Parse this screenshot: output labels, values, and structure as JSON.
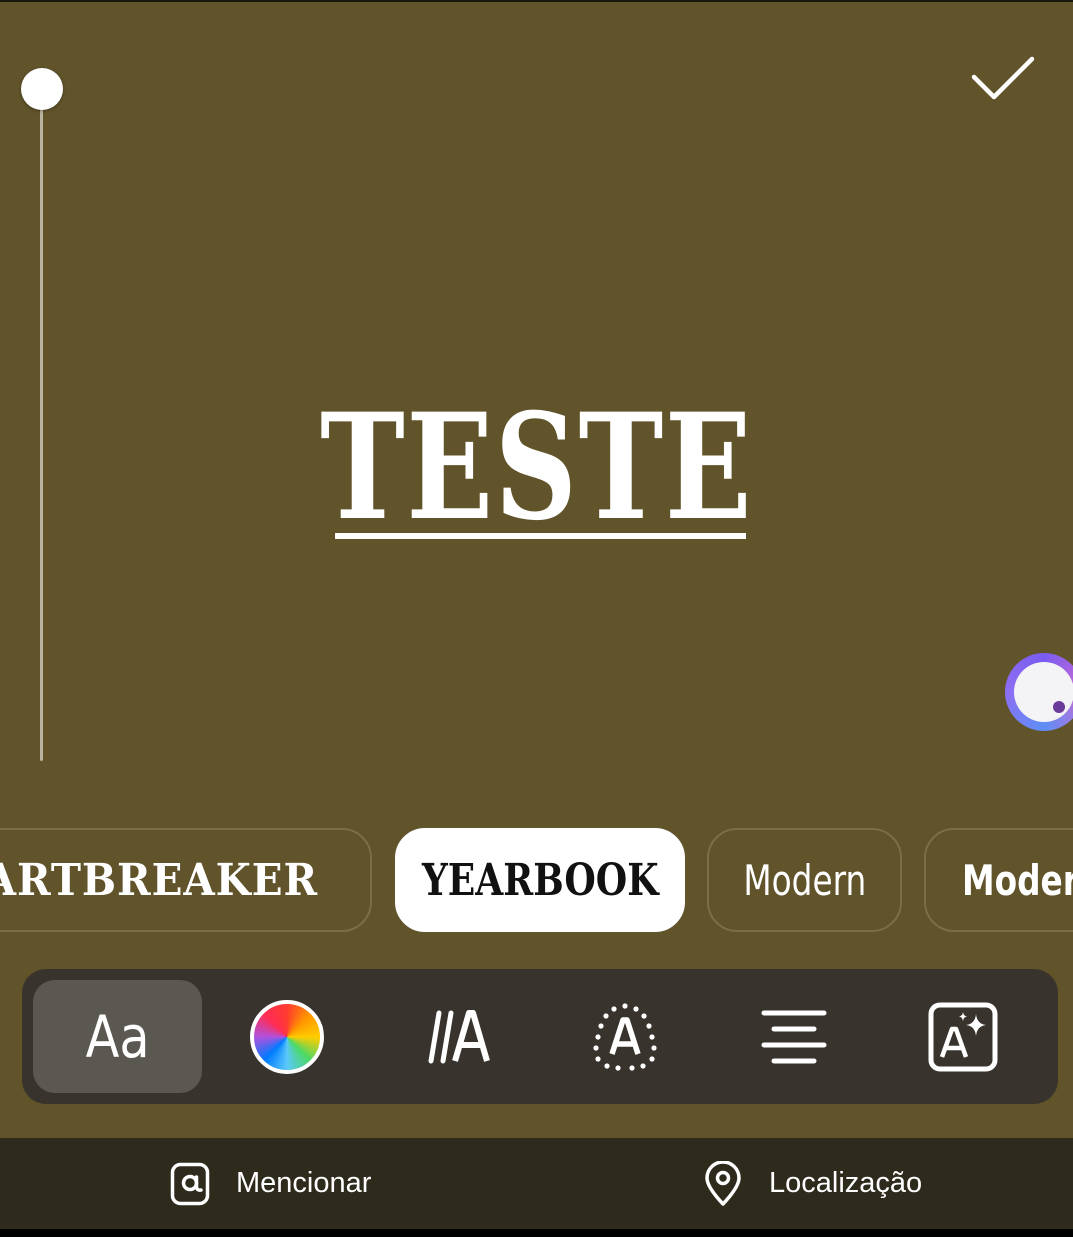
{
  "story": {
    "text": "TESTE"
  },
  "fonts": {
    "items": [
      {
        "label": "HEARTBREAKER",
        "visible_label": "EARTBREAKER"
      },
      {
        "label": "YEARBOOK"
      },
      {
        "label": "Modern"
      },
      {
        "label": "Modern"
      }
    ],
    "selected": "YEARBOOK"
  },
  "toolbar": {
    "font_tool_label": "Aa",
    "tools": [
      "font",
      "color",
      "animation",
      "effect",
      "align",
      "ai-style"
    ],
    "selected": "font"
  },
  "bottom_bar": {
    "mention_label": "Mencionar",
    "location_label": "Localização"
  },
  "colors": {
    "background": "#61542b",
    "toolbar": "#38342d",
    "bottom_bar": "#2e2a1c"
  },
  "icons": {
    "done": "check-icon",
    "mention": "at-sign-icon",
    "location": "map-pin-icon",
    "color": "color-wheel-icon",
    "animation": "text-animation-icon",
    "effect": "text-effect-icon",
    "align": "align-center-icon",
    "ai_style": "ai-sparkle-icon"
  }
}
